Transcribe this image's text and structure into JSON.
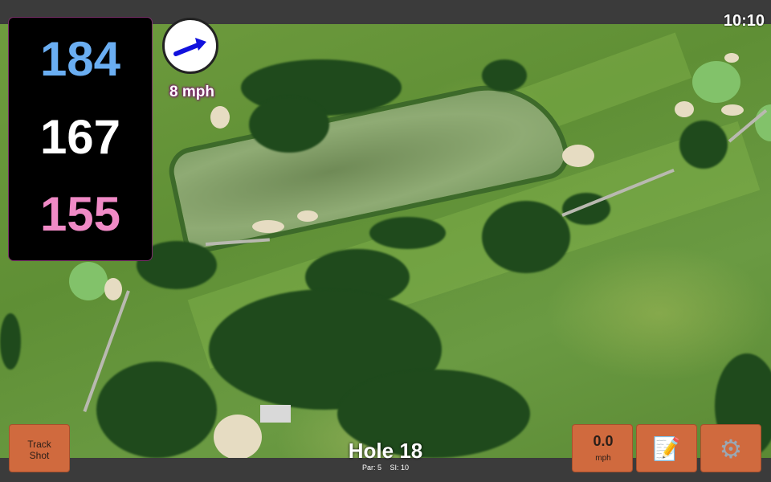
{
  "status": {
    "time": "10:10"
  },
  "distances": {
    "back": "184",
    "middle": "167",
    "front": "155"
  },
  "wind": {
    "speed_label": "8 mph",
    "direction_icon": "arrow-icon"
  },
  "hole": {
    "title": "Hole 18",
    "par": "Par: 5",
    "stroke_index": "SI: 10"
  },
  "buttons": {
    "track_shot_line1": "Track",
    "track_shot_line2": "Shot",
    "speed_value": "0.0",
    "speed_unit": "mph",
    "notes_icon": "notes-icon",
    "settings_icon": "gear-icon"
  },
  "colors": {
    "back_distance": "#6aaef2",
    "middle_distance": "#ffffff",
    "front_distance": "#f08ac6",
    "button_bg": "#d06a3e",
    "wind_arrow": "#1111dd"
  }
}
